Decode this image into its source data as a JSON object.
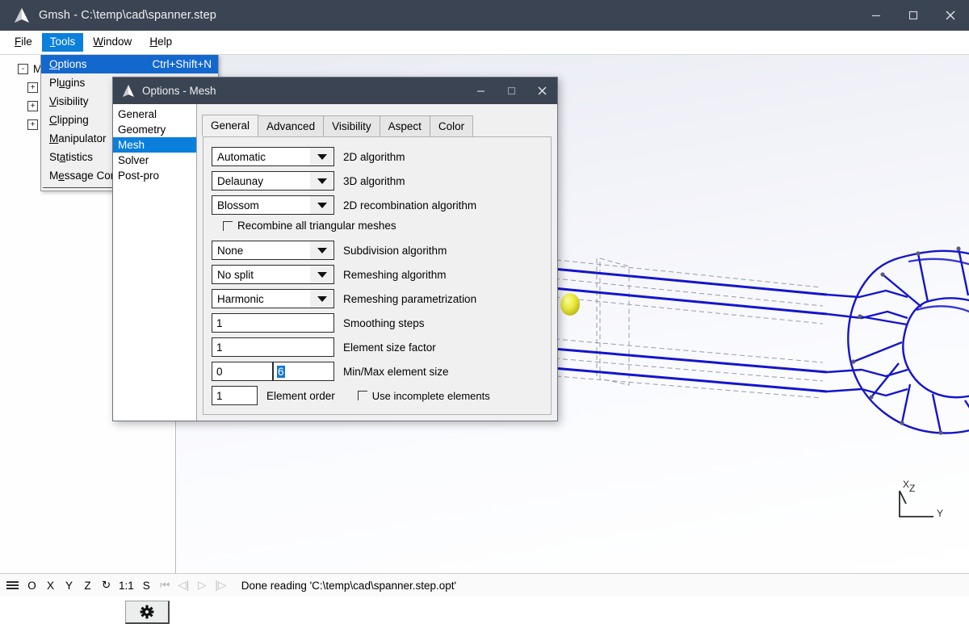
{
  "window": {
    "title": "Gmsh - C:\\temp\\cad\\spanner.step",
    "icon": "gmsh-triangle-icon",
    "controls": {
      "minimize": "minimize-icon",
      "maximize": "maximize-icon",
      "close": "close-icon"
    }
  },
  "menubar": {
    "items": [
      {
        "label": "File",
        "mnemonic": "F",
        "active": false
      },
      {
        "label": "Tools",
        "mnemonic": "T",
        "active": true
      },
      {
        "label": "Window",
        "mnemonic": "W",
        "active": false
      },
      {
        "label": "Help",
        "mnemonic": "H",
        "active": false
      }
    ]
  },
  "tools_menu": {
    "items": [
      {
        "label": "Options",
        "shortcut": "Ctrl+Shift+N",
        "selected": true
      },
      {
        "label": "Plugins",
        "shortcut": "",
        "selected": false
      },
      {
        "label": "Visibility",
        "shortcut": "",
        "selected": false
      },
      {
        "label": "Clipping",
        "shortcut": "",
        "selected": false
      },
      {
        "label": "Manipulator",
        "shortcut": "",
        "selected": false
      },
      {
        "label": "Statistics",
        "shortcut": "",
        "selected": false
      },
      {
        "label": "Message Console",
        "shortcut": "",
        "selected": false
      }
    ]
  },
  "tree_panel": {
    "rows": [
      {
        "toggle": "-",
        "label": "M"
      },
      {
        "toggle": "+",
        "label": ""
      },
      {
        "toggle": "+",
        "label": ""
      },
      {
        "toggle": "+",
        "label": ""
      }
    ],
    "gear_button": "gear-icon"
  },
  "dialog": {
    "icon": "gmsh-triangle-icon",
    "title": "Options - Mesh",
    "controls": {
      "minimize": "minimize-icon",
      "maximize": "maximize-icon",
      "close": "close-icon"
    },
    "categories": [
      {
        "label": "General",
        "selected": false
      },
      {
        "label": "Geometry",
        "selected": false
      },
      {
        "label": "Mesh",
        "selected": true
      },
      {
        "label": "Solver",
        "selected": false
      },
      {
        "label": "Post-pro",
        "selected": false
      }
    ],
    "tabs": [
      {
        "label": "General",
        "selected": true
      },
      {
        "label": "Advanced",
        "selected": false
      },
      {
        "label": "Visibility",
        "selected": false
      },
      {
        "label": "Aspect",
        "selected": false
      },
      {
        "label": "Color",
        "selected": false
      }
    ],
    "fields": {
      "algo2d": {
        "value": "Automatic",
        "label": "2D algorithm"
      },
      "algo3d": {
        "value": "Delaunay",
        "label": "3D algorithm"
      },
      "recomb2d": {
        "value": "Blossom",
        "label": "2D recombination algorithm"
      },
      "recombine_all": {
        "label": "Recombine all triangular meshes",
        "checked": false
      },
      "subdivision": {
        "value": "None",
        "label": "Subdivision algorithm"
      },
      "remeshing": {
        "value": "No split",
        "label": "Remeshing algorithm"
      },
      "remesh_param": {
        "value": "Harmonic",
        "label": "Remeshing parametrization"
      },
      "smoothing": {
        "value": "1",
        "label": "Smoothing steps"
      },
      "size_factor": {
        "value": "1",
        "label": "Element size factor"
      },
      "min_size": {
        "value": "0",
        "label": "Min/Max element size"
      },
      "max_size": {
        "value": "6",
        "selected": true
      },
      "element_order": {
        "value": "1",
        "label": "Element order"
      },
      "incomplete": {
        "label": "Use incomplete elements",
        "checked": false
      }
    }
  },
  "viewport": {
    "axis_labels": {
      "x": "X",
      "y": "Y",
      "z": "Z"
    },
    "model_colors": {
      "edge": "#1414cc",
      "hidden": "#9a9aa6",
      "node": "#e2e23a"
    }
  },
  "statusbar": {
    "icons": [
      {
        "name": "menu-icon",
        "glyph": "",
        "dim": false
      },
      {
        "name": "origin-button",
        "glyph": "O",
        "dim": false
      },
      {
        "name": "x-axis-button",
        "glyph": "X",
        "dim": false
      },
      {
        "name": "y-axis-button",
        "glyph": "Y",
        "dim": false
      },
      {
        "name": "z-axis-button",
        "glyph": "Z",
        "dim": false
      },
      {
        "name": "rotate-button",
        "glyph": "↻",
        "dim": false
      },
      {
        "name": "scale-button",
        "glyph": "1:1",
        "dim": false
      },
      {
        "name": "snapshot-button",
        "glyph": "S",
        "dim": false
      },
      {
        "name": "first-frame-button",
        "glyph": "⏮",
        "dim": true
      },
      {
        "name": "previous-frame-button",
        "glyph": "◁|",
        "dim": true
      },
      {
        "name": "play-button",
        "glyph": "▷",
        "dim": true
      },
      {
        "name": "next-frame-button",
        "glyph": "|▷",
        "dim": true
      }
    ],
    "message": "Done reading 'C:\\temp\\cad\\spanner.step.opt'"
  }
}
